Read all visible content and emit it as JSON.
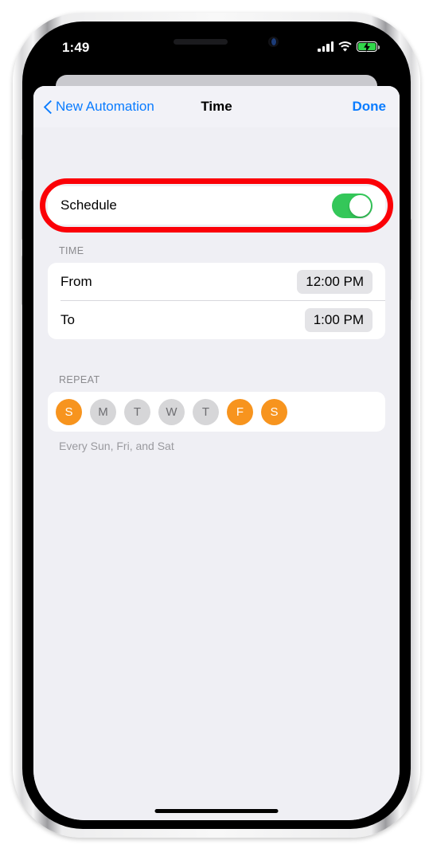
{
  "status_bar": {
    "time": "1:49",
    "signal_icon": "cellular-signal-icon",
    "wifi_icon": "wifi-icon",
    "battery_icon": "battery-charging-icon",
    "battery_color": "#32d74b"
  },
  "navbar": {
    "back_label": "New Automation",
    "back_icon": "chevron-left-icon",
    "title": "Time",
    "done_label": "Done",
    "accent_color": "#0a7cff"
  },
  "schedule": {
    "label": "Schedule",
    "toggle_on": true,
    "toggle_on_color": "#34c759",
    "highlight_color": "#fb0007"
  },
  "time_section": {
    "header": "TIME",
    "rows": [
      {
        "label": "From",
        "value": "12:00 PM"
      },
      {
        "label": "To",
        "value": "1:00 PM"
      }
    ]
  },
  "repeat_section": {
    "header": "REPEAT",
    "selected_color": "#f7941e",
    "unselected_color": "#d6d6d8",
    "days": [
      {
        "letter": "S",
        "name": "sunday",
        "selected": true
      },
      {
        "letter": "M",
        "name": "monday",
        "selected": false
      },
      {
        "letter": "T",
        "name": "tuesday",
        "selected": false
      },
      {
        "letter": "W",
        "name": "wednesday",
        "selected": false
      },
      {
        "letter": "T",
        "name": "thursday",
        "selected": false
      },
      {
        "letter": "F",
        "name": "friday",
        "selected": true
      },
      {
        "letter": "S",
        "name": "saturday",
        "selected": true
      }
    ],
    "summary": "Every Sun, Fri, and Sat"
  }
}
